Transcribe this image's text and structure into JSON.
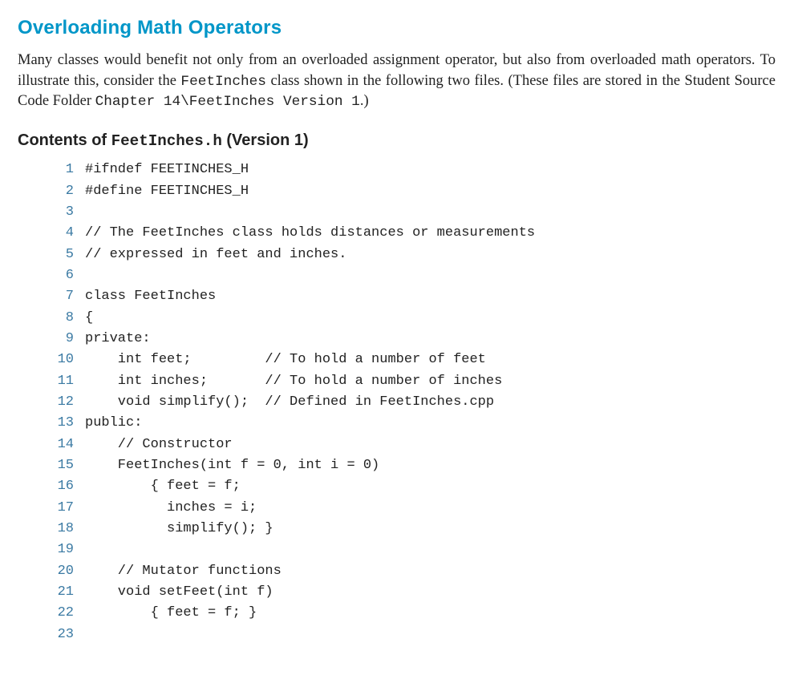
{
  "title": "Overloading Math Operators",
  "para": {
    "p1a": "Many classes would benefit not only from an overloaded assignment operator, but also from overloaded math operators. To illustrate this, consider the ",
    "p1_code1": "FeetInches",
    "p1b": " class shown in the following two files. (These files are stored in the Student Source Code Folder ",
    "p1_code2": "Chapter 14\\FeetInches Version 1",
    "p1c": ".)"
  },
  "contents_head": {
    "prefix": "Contents of ",
    "filename": "FeetInches.h",
    "suffix": " (Version 1)"
  },
  "code": [
    {
      "n": "1",
      "t": "#ifndef FEETINCHES_H"
    },
    {
      "n": "2",
      "t": "#define FEETINCHES_H"
    },
    {
      "n": "3",
      "t": ""
    },
    {
      "n": "4",
      "t": "// The FeetInches class holds distances or measurements"
    },
    {
      "n": "5",
      "t": "// expressed in feet and inches."
    },
    {
      "n": "6",
      "t": ""
    },
    {
      "n": "7",
      "t": "class FeetInches"
    },
    {
      "n": "8",
      "t": "{"
    },
    {
      "n": "9",
      "t": "private:"
    },
    {
      "n": "10",
      "t": "    int feet;         // To hold a number of feet"
    },
    {
      "n": "11",
      "t": "    int inches;       // To hold a number of inches"
    },
    {
      "n": "12",
      "t": "    void simplify();  // Defined in FeetInches.cpp"
    },
    {
      "n": "13",
      "t": "public:"
    },
    {
      "n": "14",
      "t": "    // Constructor"
    },
    {
      "n": "15",
      "t": "    FeetInches(int f = 0, int i = 0)"
    },
    {
      "n": "16",
      "t": "        { feet = f;"
    },
    {
      "n": "17",
      "t": "          inches = i;"
    },
    {
      "n": "18",
      "t": "          simplify(); }"
    },
    {
      "n": "19",
      "t": ""
    },
    {
      "n": "20",
      "t": "    // Mutator functions"
    },
    {
      "n": "21",
      "t": "    void setFeet(int f)"
    },
    {
      "n": "22",
      "t": "        { feet = f; }"
    },
    {
      "n": "23",
      "t": ""
    }
  ]
}
